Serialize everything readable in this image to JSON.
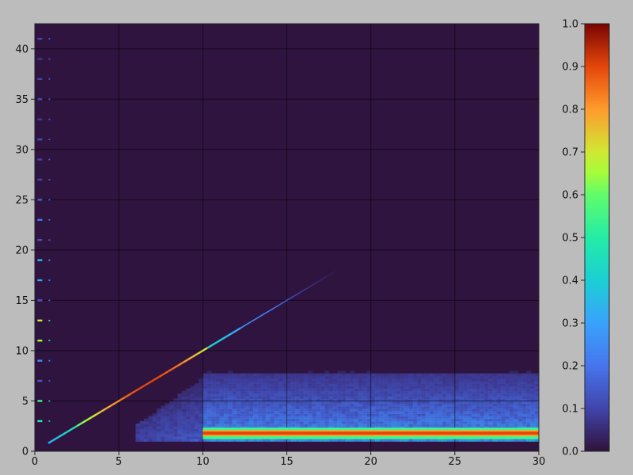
{
  "chart_data": {
    "type": "heatmap",
    "title": "",
    "xlabel": "",
    "ylabel": "",
    "xlim": [
      0,
      30
    ],
    "ylim": [
      0,
      42.5
    ],
    "x_ticks": [
      "0",
      "5",
      "10",
      "15",
      "20",
      "25",
      "30"
    ],
    "y_ticks": [
      "0",
      "5",
      "10",
      "15",
      "20",
      "25",
      "30",
      "35",
      "40"
    ],
    "grid": true,
    "colormap": "turbo",
    "background_color": "#2f1440",
    "colorbar": {
      "range": [
        0.0,
        1.0
      ],
      "ticks": [
        "0.0",
        "0.1",
        "0.2",
        "0.3",
        "0.4",
        "0.5",
        "0.6",
        "0.7",
        "0.8",
        "0.9",
        "1.0"
      ]
    },
    "features": {
      "diagonal_ridge": {
        "description": "intensity ridge along y = x",
        "x_range": [
          0.8,
          18
        ],
        "peak_value_range": [
          0.6,
          0.9
        ]
      },
      "harmonic_band": {
        "description": "strong band near y ≈ 1.8 for x ≥ 10",
        "x_range": [
          10,
          30
        ],
        "y": 1.8,
        "peak_value": 0.9
      },
      "broad_region": {
        "x_range": [
          6,
          30
        ],
        "y_range": [
          1,
          10
        ],
        "typical_value_range": [
          0.05,
          0.35
        ]
      },
      "left_column_points": {
        "x": 0.3,
        "y": [
          3,
          5,
          7,
          9,
          11,
          13,
          15,
          17,
          19,
          21,
          23,
          25,
          27,
          29,
          31,
          33,
          35,
          37,
          39,
          41
        ],
        "values": [
          0.5,
          0.55,
          0.15,
          0.25,
          0.65,
          0.7,
          0.15,
          0.3,
          0.35,
          0.12,
          0.2,
          0.15,
          0.1,
          0.1,
          0.12,
          0.08,
          0.12,
          0.1,
          0.08,
          0.1
        ]
      }
    }
  }
}
